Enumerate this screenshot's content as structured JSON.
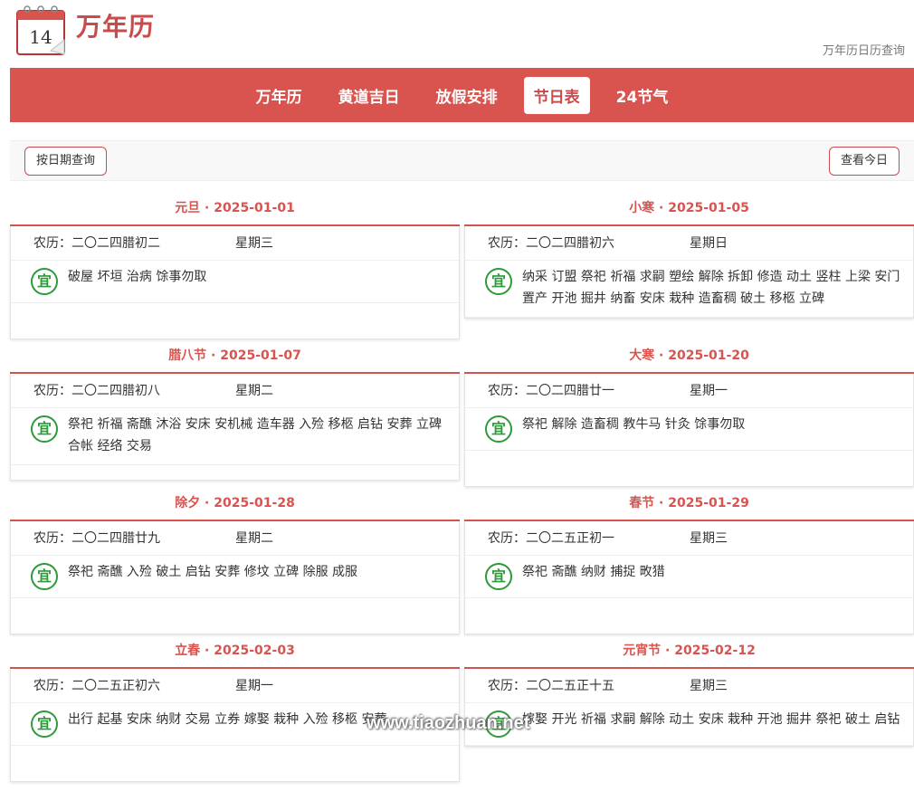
{
  "header": {
    "logo_text": "14",
    "title": "万年历",
    "subtitle": "万年历日历查询"
  },
  "nav": {
    "items": [
      {
        "label": "万年历",
        "active": false
      },
      {
        "label": "黄道吉日",
        "active": false
      },
      {
        "label": "放假安排",
        "active": false
      },
      {
        "label": "节日表",
        "active": true
      },
      {
        "label": "24节气",
        "active": false
      }
    ]
  },
  "toolbar": {
    "query_label": "按日期查询",
    "today_label": "查看今日"
  },
  "cards": [
    {
      "title": "元旦 · 2025-01-01",
      "lunar": "农历：二〇二四腊初二",
      "week": "星期三",
      "yi_icon": "宜",
      "yi": "破屋 坏垣 治病 馀事勿取"
    },
    {
      "title": "小寒 · 2025-01-05",
      "lunar": "农历：二〇二四腊初六",
      "week": "星期日",
      "yi_icon": "宜",
      "yi": "纳采 订盟 祭祀 祈福 求嗣 塑绘 解除 拆卸 修造 动土 竖柱 上梁 安门 置产 开池 掘井 纳畜 安床 栽种 造畜稠 破土 移柩 立碑"
    },
    {
      "title": "腊八节 · 2025-01-07",
      "lunar": "农历：二〇二四腊初八",
      "week": "星期二",
      "yi_icon": "宜",
      "yi": "祭祀 祈福 斋醮 沐浴 安床 安机械 造车器 入殓 移柩 启钻 安葬 立碑 合帐 经络 交易"
    },
    {
      "title": "大寒 · 2025-01-20",
      "lunar": "农历：二〇二四腊廿一",
      "week": "星期一",
      "yi_icon": "宜",
      "yi": "祭祀 解除 造畜稠 教牛马 针灸 馀事勿取"
    },
    {
      "title": "除夕 · 2025-01-28",
      "lunar": "农历：二〇二四腊廿九",
      "week": "星期二",
      "yi_icon": "宜",
      "yi": "祭祀 斋醮 入殓 破土 启钻 安葬 修坟 立碑 除服 成服"
    },
    {
      "title": "春节 · 2025-01-29",
      "lunar": "农历：二〇二五正初一",
      "week": "星期三",
      "yi_icon": "宜",
      "yi": "祭祀 斋醮 纳财 捕捉 畋猎"
    },
    {
      "title": "立春 · 2025-02-03",
      "lunar": "农历：二〇二五正初六",
      "week": "星期一",
      "yi_icon": "宜",
      "yi": "出行 起基 安床 纳财 交易 立券 嫁娶 栽种 入殓 移柩 安葬"
    },
    {
      "title": "元宵节 · 2025-02-12",
      "lunar": "农历：二〇二五正十五",
      "week": "星期三",
      "yi_icon": "宜",
      "yi": "嫁娶 开光 祈福 求嗣 解除 动土 安床 栽种 开池 掘井 祭祀 破土 启钻"
    }
  ],
  "watermark": "www.tiaozhuan.net",
  "colors": {
    "accent": "#d9534f",
    "yi_green": "#2e9a3a"
  }
}
